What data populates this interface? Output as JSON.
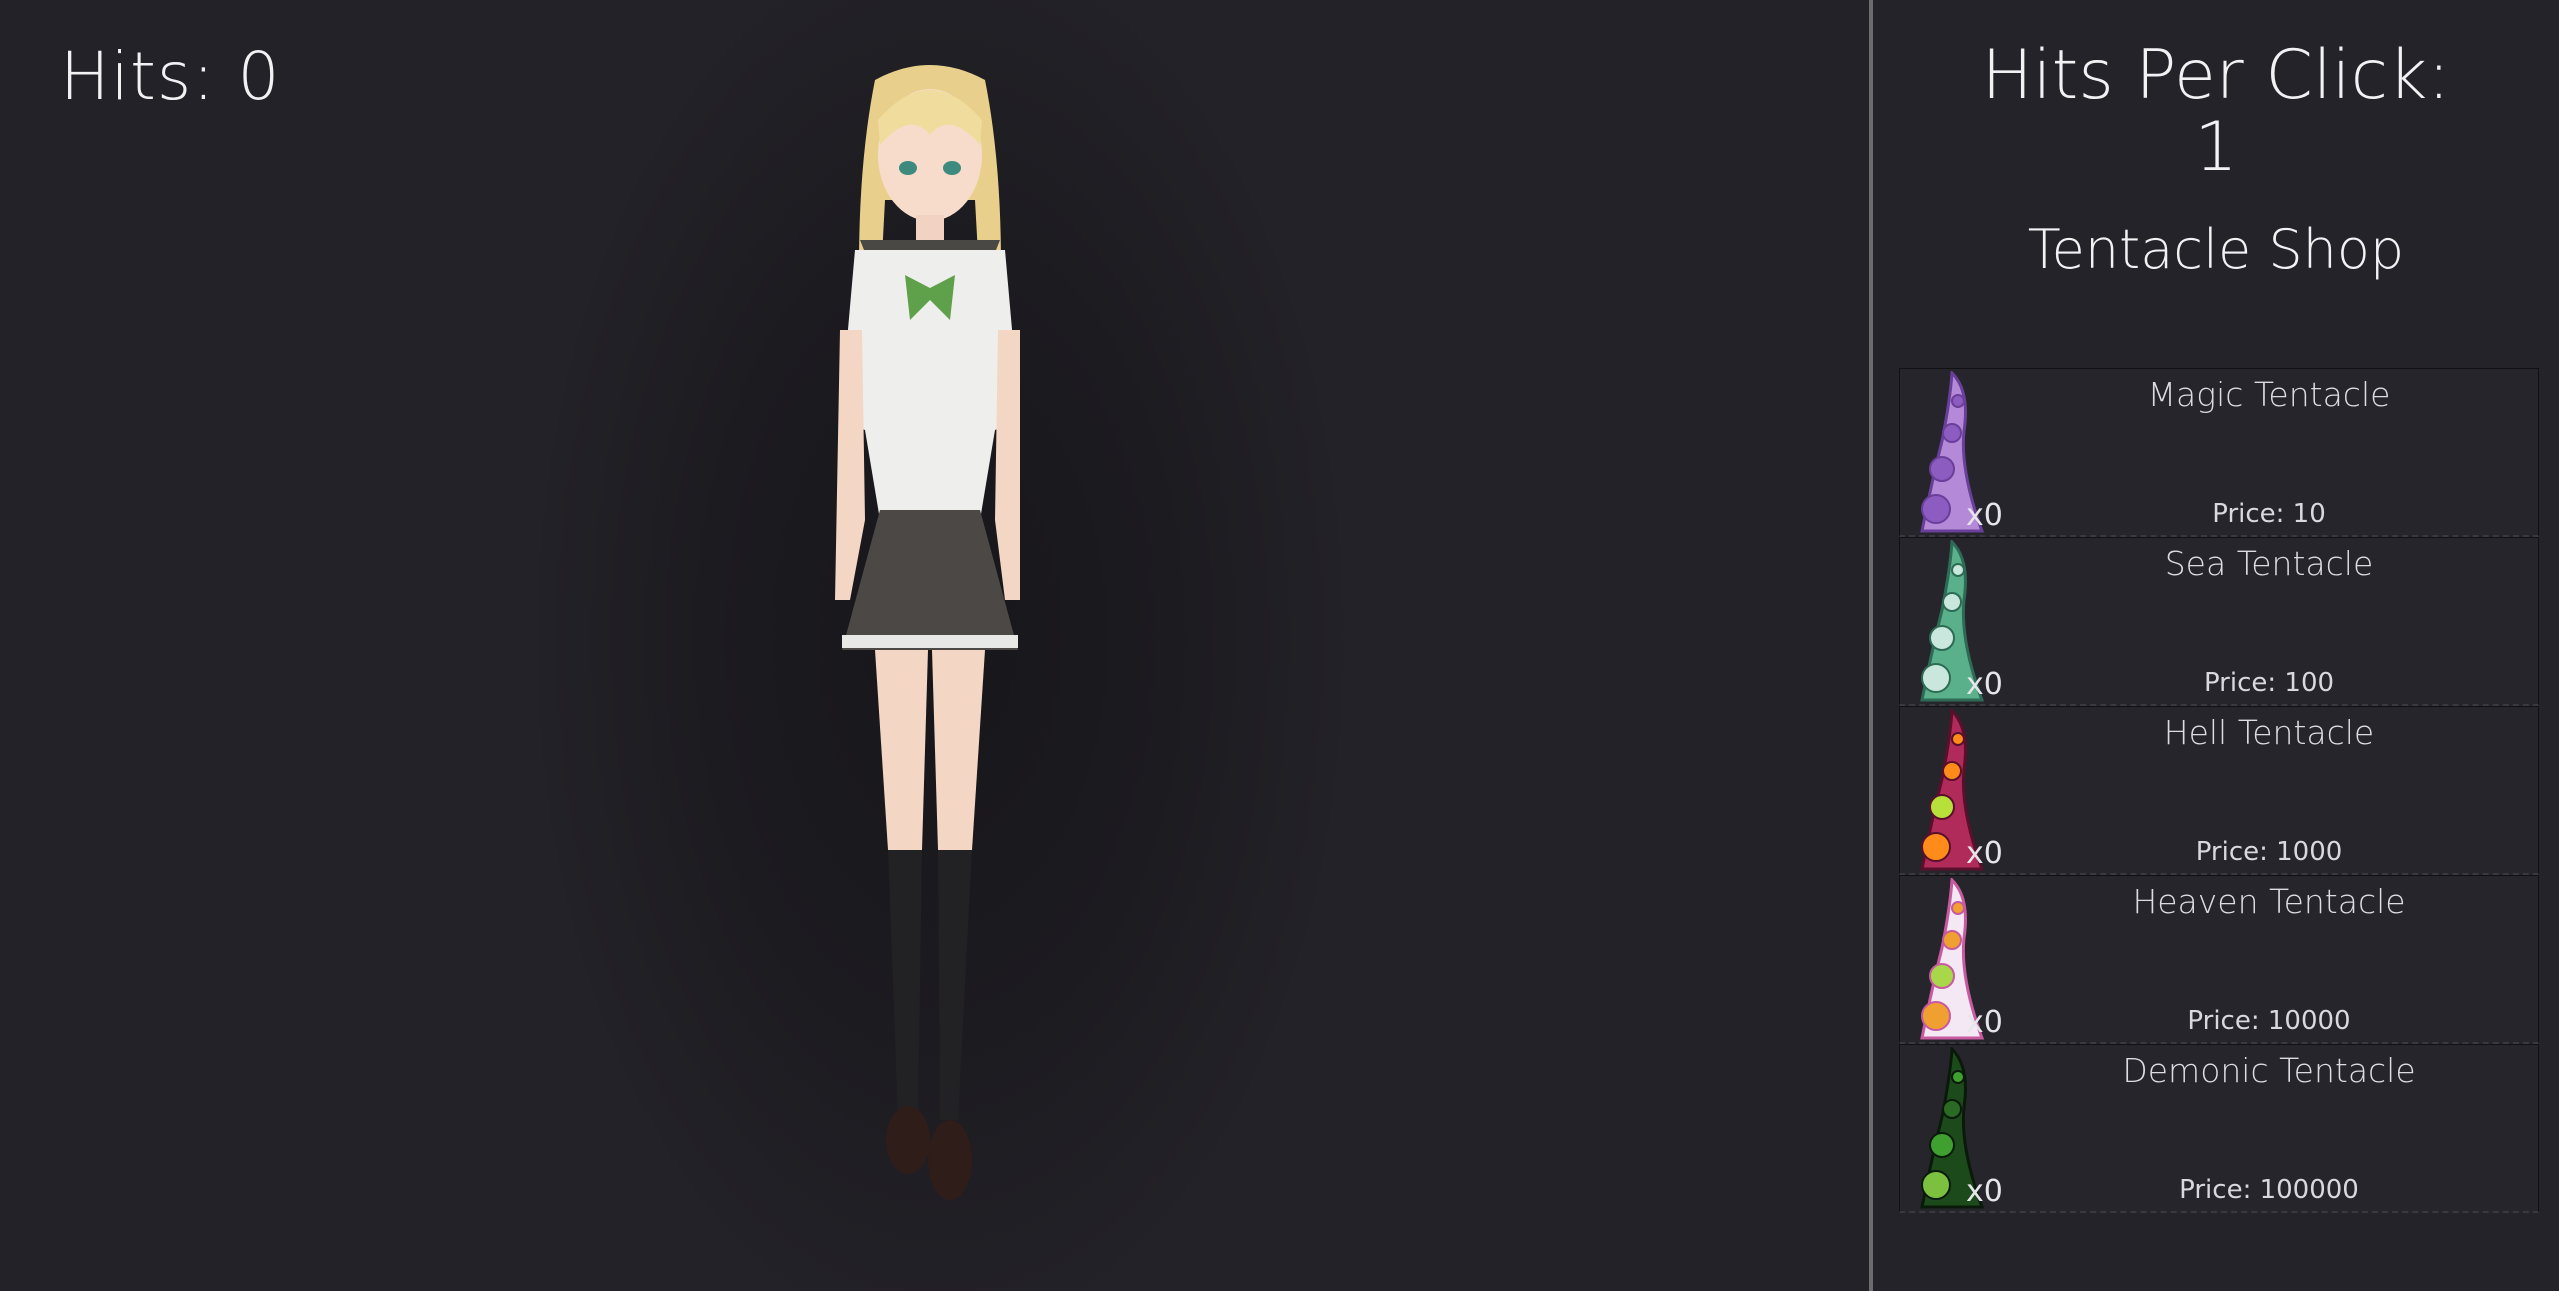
{
  "game": {
    "hits_label": "Hits: 0",
    "hits_per_click_label": "Hits Per Click:",
    "hits_per_click_value": "1",
    "shop_title": "Tentacle Shop"
  },
  "shop": {
    "items": [
      {
        "name": "Magic Tentacle",
        "count": "x0",
        "price": "Price: 10",
        "icon": "magic-tentacle-icon",
        "color_main": "#b48ad8",
        "color_dark": "#6a3f9a",
        "color_sucker": "#8c5cc0"
      },
      {
        "name": "Sea Tentacle",
        "count": "x0",
        "price": "Price: 100",
        "icon": "sea-tentacle-icon",
        "color_main": "#59b08a",
        "color_dark": "#2d6b55",
        "color_sucker": "#c9e7dc"
      },
      {
        "name": "Hell Tentacle",
        "count": "x0",
        "price": "Price: 1000",
        "icon": "hell-tentacle-icon",
        "color_main": "#b02a5a",
        "color_dark": "#5a0f2a",
        "color_sucker": "#ff8c1a"
      },
      {
        "name": "Heaven Tentacle",
        "count": "x0",
        "price": "Price: 10000",
        "icon": "heaven-tentacle-icon",
        "color_main": "#f4e8f4",
        "color_dark": "#c85aa0",
        "color_sucker": "#f0a030"
      },
      {
        "name": "Demonic Tentacle",
        "count": "x0",
        "price": "Price: 100000",
        "icon": "demonic-tentacle-icon",
        "color_main": "#1d4a1a",
        "color_dark": "#0a1a0a",
        "color_sucker": "#3fa030"
      }
    ]
  }
}
